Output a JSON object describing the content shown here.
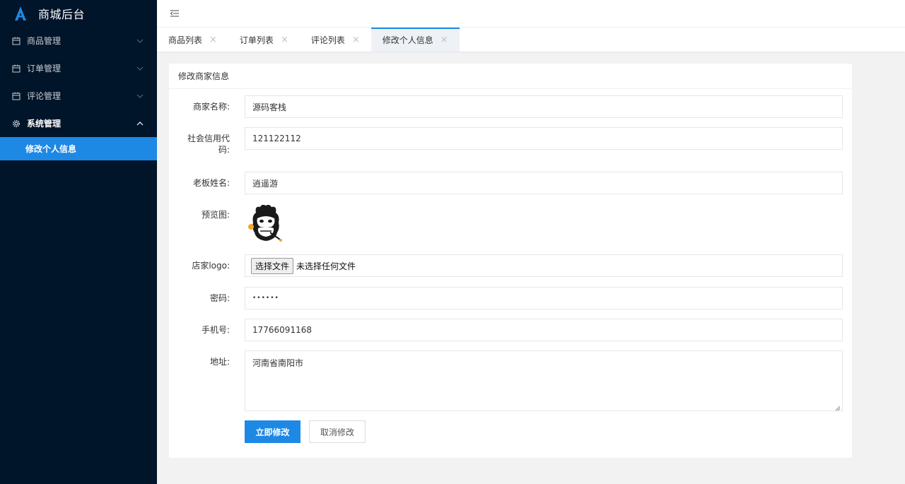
{
  "app": {
    "title": "商城后台"
  },
  "sidebar": {
    "items": [
      {
        "label": "商品管理",
        "icon": "calendar-icon",
        "chevron": "chevron-down-icon"
      },
      {
        "label": "订单管理",
        "icon": "calendar-icon",
        "chevron": "chevron-down-icon"
      },
      {
        "label": "评论管理",
        "icon": "calendar-icon",
        "chevron": "chevron-down-icon"
      },
      {
        "label": "系统管理",
        "icon": "gear-icon",
        "chevron": "chevron-up-icon"
      }
    ],
    "sub_items": [
      {
        "label": "修改个人信息"
      }
    ]
  },
  "header": {
    "toggle_icon": "menu-fold-icon"
  },
  "tabs": [
    {
      "label": "商品列表"
    },
    {
      "label": "订单列表"
    },
    {
      "label": "评论列表"
    },
    {
      "label": "修改个人信息"
    }
  ],
  "form": {
    "title": "修改商家信息",
    "merchant_name": {
      "label": "商家名称:",
      "value": "源码客栈"
    },
    "credit_code": {
      "label_line1": "社会信用代",
      "label_line2": "码:",
      "value": "121122112"
    },
    "boss_name": {
      "label": "老板姓名:",
      "value": "逍遥游"
    },
    "preview": {
      "label": "预览图:"
    },
    "logo": {
      "label": "店家logo:",
      "button": "选择文件",
      "status": "未选择任何文件"
    },
    "password": {
      "label": "密码:",
      "value": "••••••"
    },
    "phone": {
      "label": "手机号:",
      "value": "17766091168"
    },
    "address": {
      "label": "地址:",
      "value": "河南省南阳市"
    },
    "submit_label": "立即修改",
    "cancel_label": "取消修改"
  },
  "colors": {
    "sidebar_bg": "#001529",
    "accent": "#1e88e5",
    "page_bg": "#f2f2f2"
  }
}
